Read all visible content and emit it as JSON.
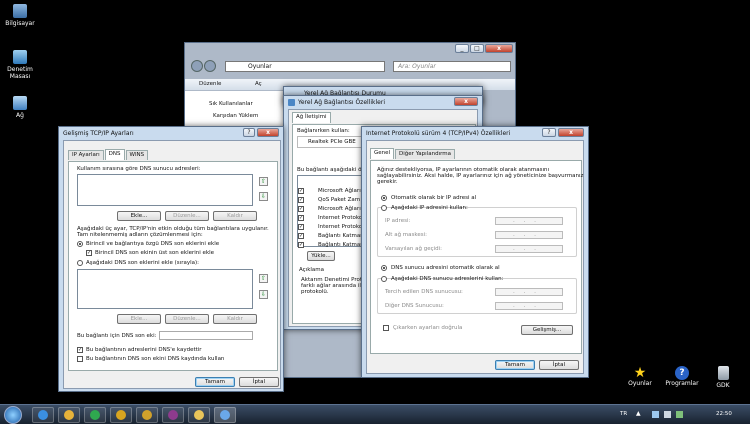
{
  "desktop": {
    "left_icons": [
      "Bilgisayar",
      "Denetim Masası",
      "Ağ"
    ],
    "right_icons": [
      "Oyunlar",
      "Programlar",
      "GDK"
    ]
  },
  "explorer": {
    "breadcrumb": "Oyunlar",
    "search_placeholder": "Ara: Oyunlar",
    "menu": [
      "Düzenle",
      "Aç"
    ],
    "nav_items": [
      "Sık Kullanılanlar",
      "Karşıdan Yüklem"
    ]
  },
  "durum_title": "Yerel Ağ Bağlantısı Durumu",
  "ozellikler": {
    "title": "Yerel Ağ Bağlantısı Özellikleri",
    "tab": "Ağ İletişimi",
    "connect_using_label": "Bağlanırken kullan:",
    "adapter": "Realtek PCIe GBE",
    "items_label": "Bu bağlantı aşağıdaki öğ",
    "items": [
      "Microsoft Ağları",
      "QoS Paket Zam",
      "Microsoft Ağları",
      "Internet Protoko",
      "Internet Protoko",
      "Bağlantı Katman",
      "Bağlantı Katman"
    ],
    "install_button": "Yükle...",
    "description_label": "Açıklama",
    "description_text": [
      "Aktarım Denetimi Protoc",
      "farklı ağlar arasında ile",
      "protokolü."
    ]
  },
  "ipv4": {
    "title": "Internet Protokolü sürüm 4 (TCP/IPv4) Özellikleri",
    "tabs": [
      "Genel",
      "Diğer Yapılandırma"
    ],
    "intro": [
      "Ağınız destekliyorsa, IP ayarlarının otomatik olarak atanmasını",
      "sağlayabilirsiniz. Aksi halde, IP ayarlarınız için ağ yöneticinize başvurmanız",
      "gerekir."
    ],
    "auto_ip": "Otomatik olarak bir IP adresi al",
    "manual_ip": "Aşağıdaki IP adresini kullan:",
    "ip_fields": [
      "IP adresi:",
      "Alt ağ maskesi:",
      "Varsayılan ağ geçidi:"
    ],
    "auto_dns": "DNS sunucu adresini otomatik olarak al",
    "manual_dns": "Aşağıdaki DNS sunucu adreslerini kullan:",
    "dns_fields": [
      "Tercih edilen DNS sunucusu:",
      "Diğer DNS Sunucusu:"
    ],
    "validate": "Çıkarken ayarları doğrula",
    "advanced": "Gelişmiş...",
    "ok": "Tamam",
    "cancel": "İptal"
  },
  "advanced": {
    "title": "Gelişmiş TCP/IP Ayarları",
    "tabs": [
      "IP Ayarları",
      "DNS",
      "WINS"
    ],
    "dns_list_label": "Kullanım sırasına göre DNS sunucu adresleri:",
    "add": "Ekle...",
    "edit": "Düzenle...",
    "remove": "Kaldır",
    "note": [
      "Aşağıdaki üç ayar, TCP/IP'nin etkin olduğu tüm bağlantılara uygulanır.",
      "Tam nitelenmemiş adların çözümlenmesi için:"
    ],
    "append_primary": "Birincil ve bağlantıya özgü DNS son eklerini ekle",
    "append_parent": "Birincil DNS son ekinin üst son eklerini ekle",
    "append_these": "Aşağıdaki DNS son eklerini ekle (sırayla):",
    "suffix_label": "Bu bağlantı için DNS son eki:",
    "register": "Bu bağlantının adreslerini DNS'e kaydettir",
    "use_suffix": "Bu bağlantının DNS son ekini DNS kaydında kullan",
    "ok": "Tamam",
    "cancel": "İptal"
  },
  "taskbar": {
    "lang": "TR",
    "time": "22:50"
  }
}
